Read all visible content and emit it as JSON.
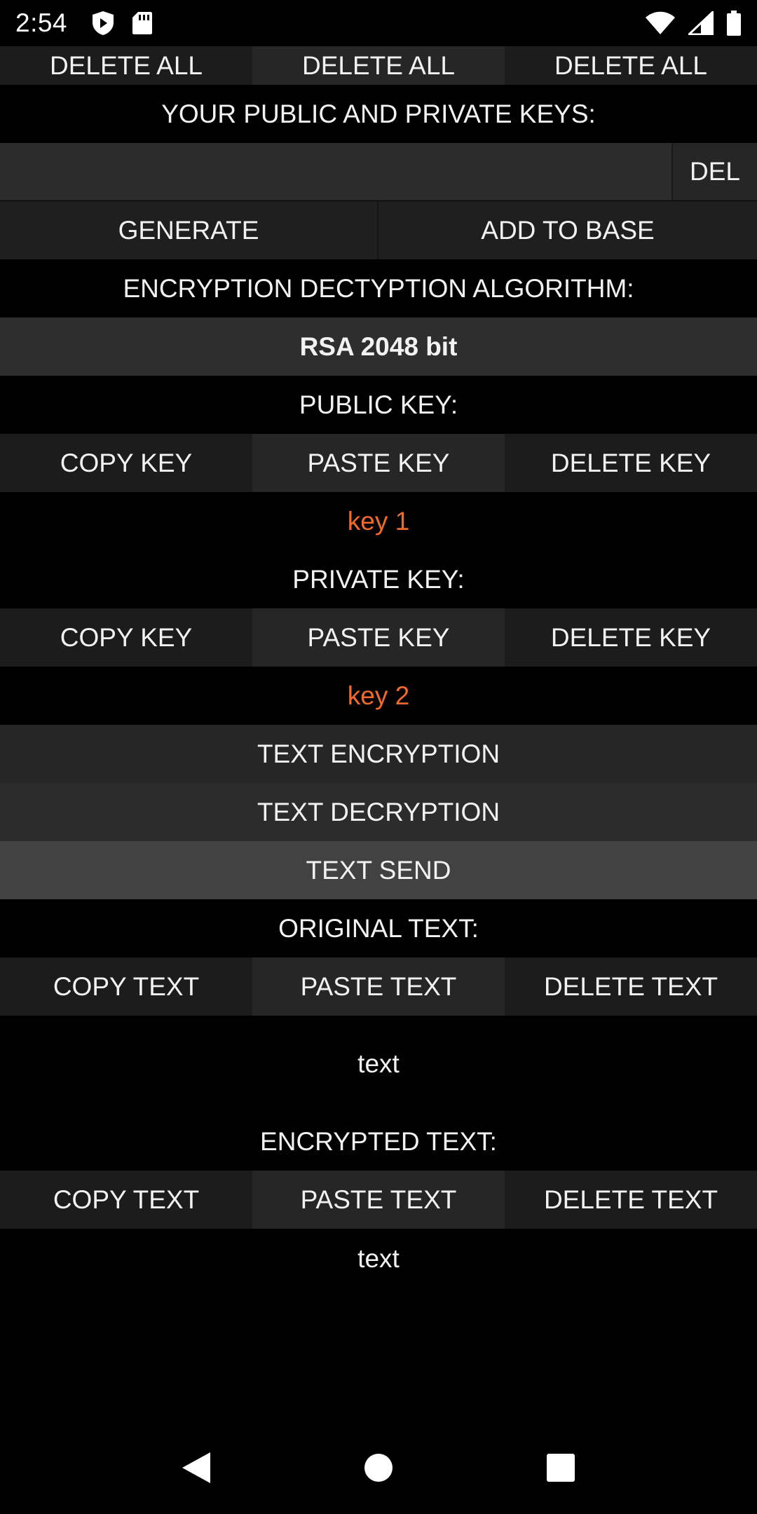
{
  "status_bar": {
    "time": "2:54"
  },
  "top_row": {
    "delete_all_1": "DELETE ALL",
    "delete_all_2": "DELETE ALL",
    "delete_all_3": "DELETE ALL"
  },
  "keys_section": {
    "title": "YOUR PUBLIC AND PRIVATE KEYS:",
    "selected_key_value": "",
    "del_label": "DEL",
    "generate_label": "GENERATE",
    "add_to_base_label": "ADD TO BASE"
  },
  "algorithm": {
    "title": "ENCRYPTION DECTYPTION ALGORITHM:",
    "selected": "RSA 2048 bit"
  },
  "public_key": {
    "title": "PUBLIC KEY:",
    "copy_label": "COPY KEY",
    "paste_label": "PASTE KEY",
    "delete_label": "DELETE KEY",
    "value": "key 1"
  },
  "private_key": {
    "title": "PRIVATE KEY:",
    "copy_label": "COPY KEY",
    "paste_label": "PASTE KEY",
    "delete_label": "DELETE KEY",
    "value": "key 2"
  },
  "actions": {
    "encrypt_label": "TEXT ENCRYPTION",
    "decrypt_label": "TEXT DECRYPTION",
    "send_label": "TEXT SEND"
  },
  "original_text": {
    "title": "ORIGINAL TEXT:",
    "copy_label": "COPY TEXT",
    "paste_label": "PASTE TEXT",
    "delete_label": "DELETE TEXT",
    "value": "text"
  },
  "encrypted_text": {
    "title": "ENCRYPTED TEXT:",
    "copy_label": "COPY TEXT",
    "paste_label": "PASTE TEXT",
    "delete_label": "DELETE TEXT",
    "value": "text"
  },
  "colors": {
    "background": "#000000",
    "button": "#1f1f1f",
    "key_value": "#f26a2b"
  },
  "icons": {
    "shield": "shield-icon",
    "sd_card": "sd-card-icon",
    "wifi": "wifi-icon",
    "signal": "signal-icon",
    "battery": "battery-icon",
    "back": "back-icon",
    "home": "home-icon",
    "recents": "recents-icon"
  }
}
